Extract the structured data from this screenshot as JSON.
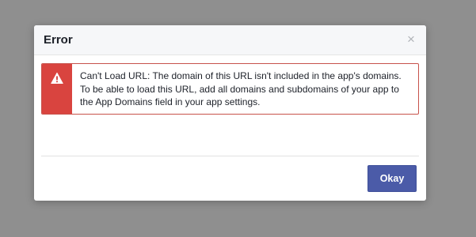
{
  "dialog": {
    "title": "Error",
    "close_icon": "×",
    "error": {
      "icon": "warning-icon",
      "message": "Can't Load URL: The domain of this URL isn't included in the app's domains. To be able to load this URL, add all domains and subdomains of your app to the App Domains field in your app settings."
    },
    "okay_label": "Okay"
  },
  "colors": {
    "overlay": "#8f8f8f",
    "error_accent": "#d9443f",
    "primary_button": "#4b5ba8"
  }
}
